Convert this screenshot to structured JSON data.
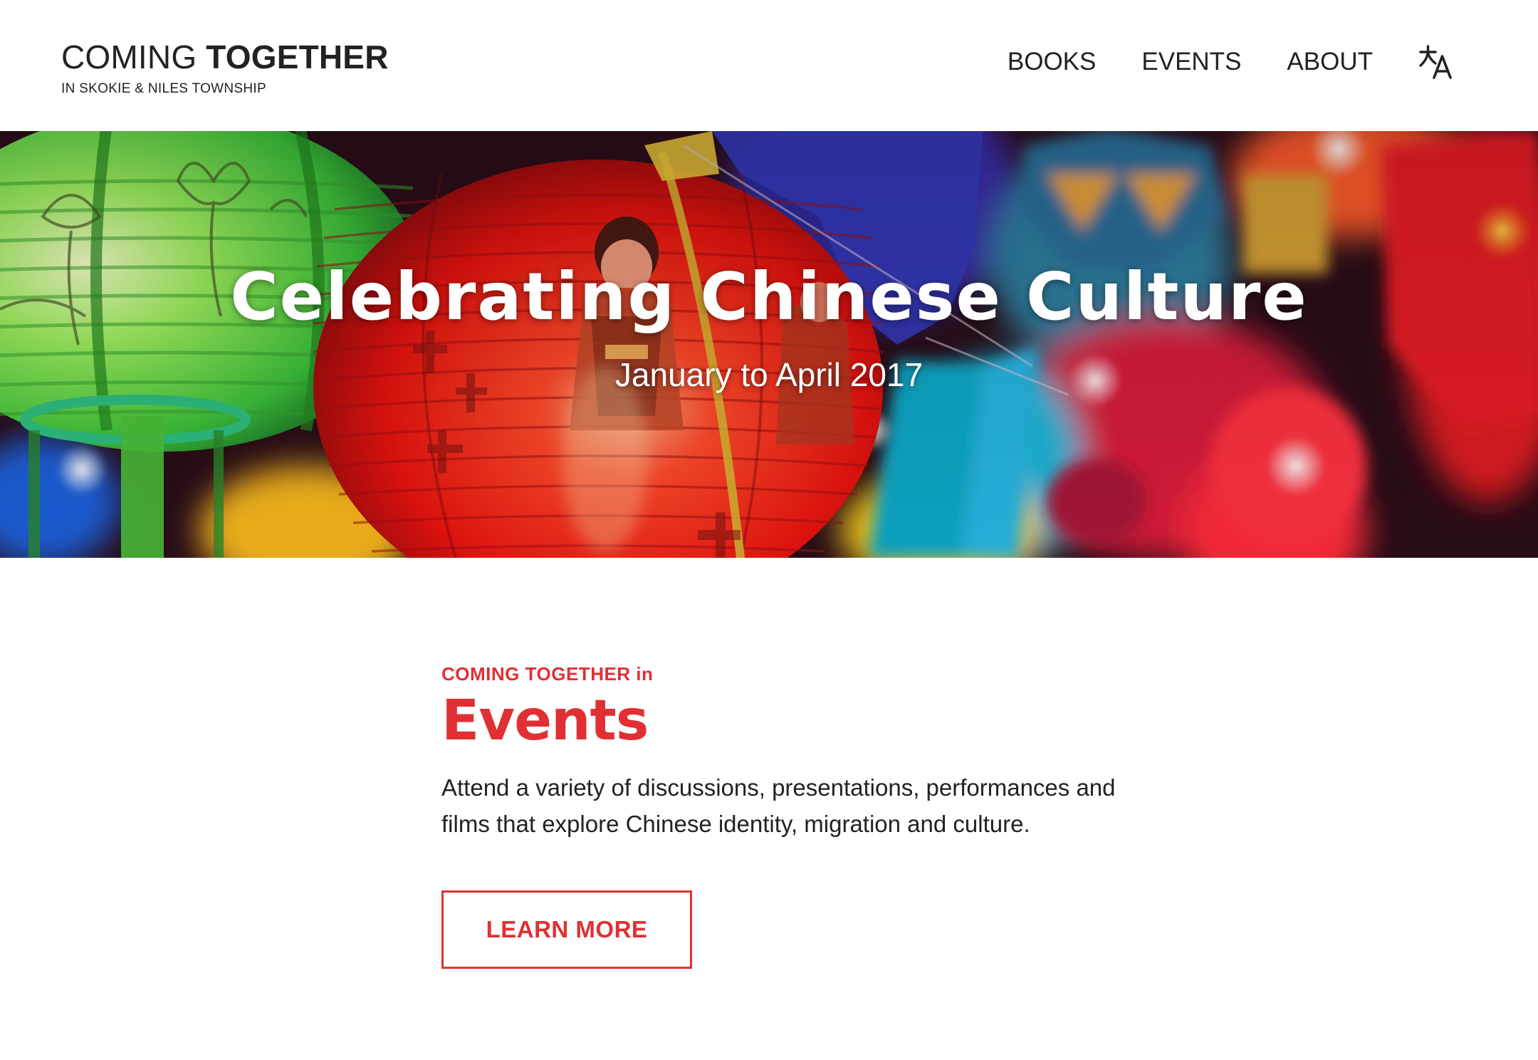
{
  "header": {
    "logo_title_light": "COMING ",
    "logo_title_bold": "TOGETHER",
    "logo_subtitle": "IN SKOKIE & NILES TOWNSHIP",
    "nav": [
      {
        "label": "BOOKS"
      },
      {
        "label": "EVENTS"
      },
      {
        "label": "ABOUT"
      }
    ],
    "translate_icon": "translate-icon"
  },
  "hero": {
    "title": "Celebrating Chinese Culture",
    "subtitle": "January to April 2017",
    "background": "lanterns-photo"
  },
  "events": {
    "eyebrow": "COMING TOGETHER in",
    "title": "Events",
    "description": "Attend a variety of discussions, presentations, performances and films that explore Chinese identity, migration and culture.",
    "cta_label": "LEARN MORE"
  },
  "colors": {
    "accent": "#e03033",
    "text": "#222222",
    "background": "#ffffff"
  }
}
